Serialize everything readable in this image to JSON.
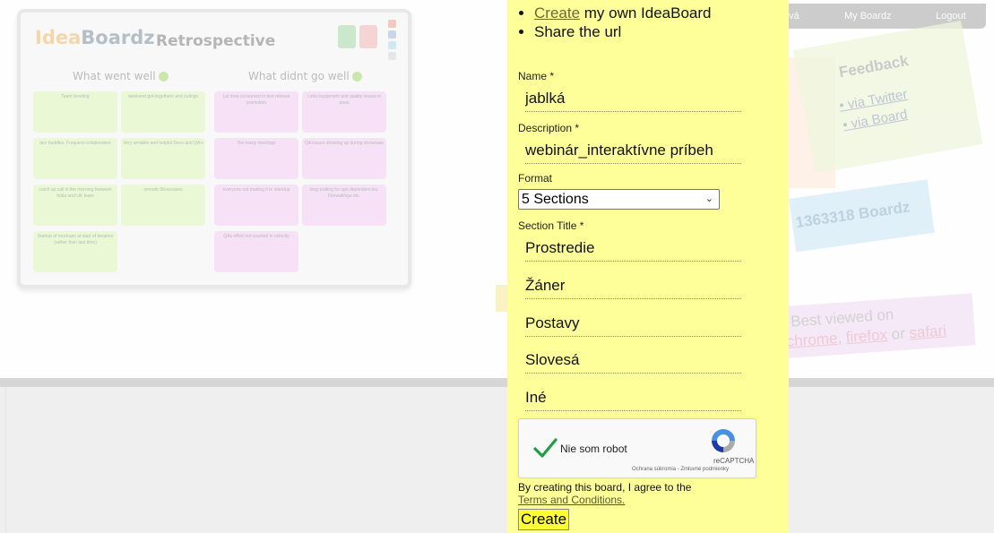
{
  "preview": {
    "logo_idea": "Idea",
    "logo_boardz": "Boardz",
    "title": "Retrospective",
    "columns": [
      "What went well",
      "What didnt go well"
    ],
    "notes_left": [
      "Team bonding",
      "weekend get-togethers and outings",
      "dev huddles. Frequent collaboration",
      "Very amiable and helpful Devs and QA's",
      "catch up call in the morning between India and UK team",
      "smooth Showcases",
      "Startup of mockups at start of iteration (rather than last time)"
    ],
    "notes_right": [
      "Lot time consumed in test release promotion",
      "Lotta equipment and quality issues in pose",
      "Too many meetings",
      "QA issues showing up during showcase",
      "everyone not making it to standup",
      "long waiting for ops dependencies. Firewall/ops etc.",
      "QAs effort not counted in velocity"
    ]
  },
  "nav": {
    "partial": "vá",
    "my_boardz": "My Boardz",
    "logout": "Logout"
  },
  "feedback": {
    "title": "Feedback",
    "links": [
      "via Twitter",
      "via Board"
    ]
  },
  "boardz_count": "1363318 Boardz",
  "best_viewed": {
    "line1": "Best viewed on",
    "chrome": "chrome",
    "sep": ", ",
    "firefox": "firefox",
    "or": " or ",
    "safari": "safari"
  },
  "form": {
    "bullets": {
      "create_link": "Create",
      "create_rest": " my own IdeaBoard",
      "share": "Share the url"
    },
    "name_label": "Name *",
    "name_value": "jablká",
    "description_label": "Description *",
    "description_value": "webinár_interaktívne príbeh",
    "format_label": "Format",
    "format_value": "5 Sections",
    "section_label": "Section Title *",
    "sections": [
      "Prostredie",
      "Žáner",
      "Postavy",
      "Slovesá",
      "Iné"
    ],
    "captcha": {
      "label": "Nie som robot",
      "brand": "reCAPTCHA",
      "links": "Ochrana súkromia - Zmluvné podmienky"
    },
    "agree_text": "By creating this board, I agree to the",
    "terms_link": "Terms and Conditions.",
    "create_button": "Create"
  }
}
